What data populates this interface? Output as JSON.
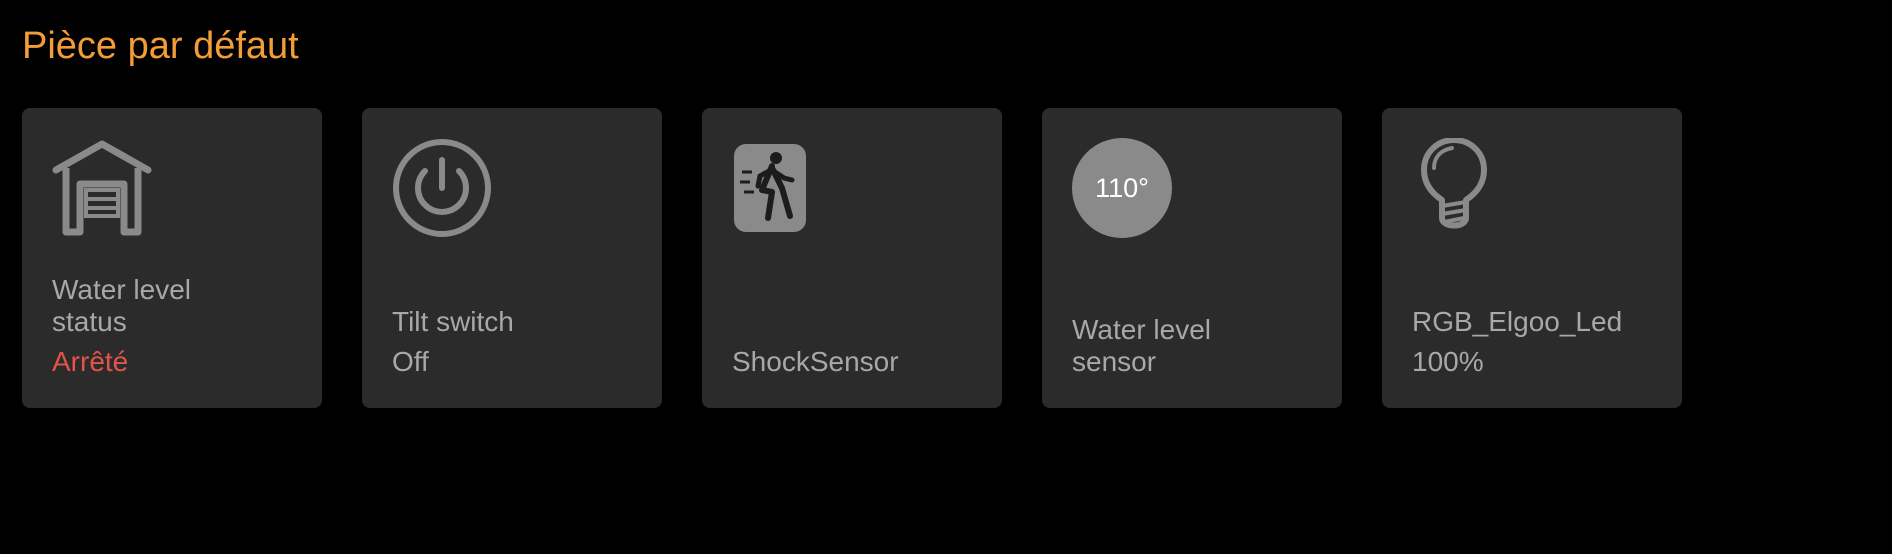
{
  "room": {
    "title": "Pièce par défaut"
  },
  "colors": {
    "title": "#f29d38",
    "tile_bg": "#2b2b2b",
    "text": "#a8a8a8",
    "icon": "#8a8a8a",
    "stopped": "#e2544a"
  },
  "tiles": [
    {
      "icon": "garage-icon",
      "name": "Water level status",
      "state": "Arrêté",
      "state_color": "#e2544a"
    },
    {
      "icon": "power-icon",
      "name": "Tilt switch",
      "state": "Off"
    },
    {
      "icon": "motion-sensor-icon",
      "name": "ShockSensor",
      "state": ""
    },
    {
      "icon": "temperature-gauge-icon",
      "gauge_value": "110°",
      "name": "Water level sensor",
      "state": ""
    },
    {
      "icon": "light-bulb-icon",
      "name": "RGB_Elgoo_Led",
      "state": "100%"
    }
  ]
}
